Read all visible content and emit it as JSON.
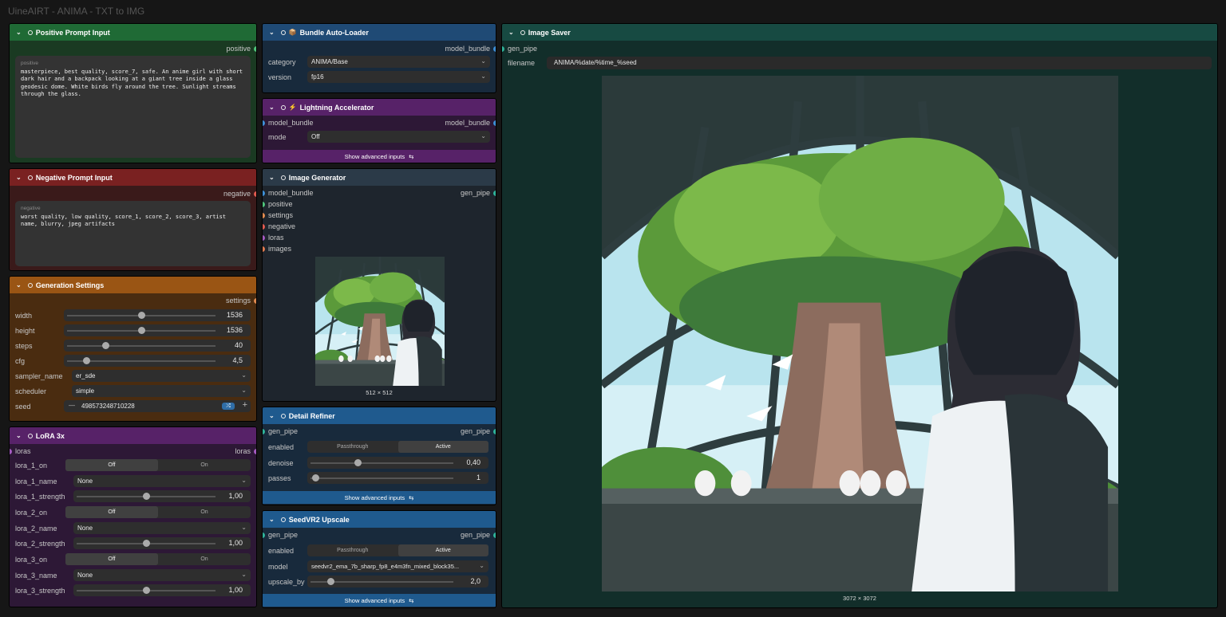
{
  "app": {
    "title": "UineAIRT - ANIMA - TXT to IMG"
  },
  "positive_node": {
    "title": "Positive Prompt Input",
    "output": "positive",
    "placeholder": "positive",
    "text": "masterpiece, best quality, score_7, safe. An anime girl with short dark hair and a backpack looking at a giant tree inside a glass geodesic dome. White birds fly around the tree. Sunlight streams through the glass."
  },
  "negative_node": {
    "title": "Negative Prompt Input",
    "output": "negative",
    "placeholder": "negative",
    "text": "worst quality, low quality, score_1, score_2, score_3, artist name, blurry, jpeg artifacts"
  },
  "settings_node": {
    "title": "Generation Settings",
    "output": "settings",
    "width_label": "width",
    "width": "1536",
    "width_fraction": 0.5,
    "height_label": "height",
    "height": "1536",
    "height_fraction": 0.5,
    "steps_label": "steps",
    "steps": "40",
    "steps_fraction": 0.26,
    "cfg_label": "cfg",
    "cfg": "4,5",
    "cfg_fraction": 0.13,
    "sampler_label": "sampler_name",
    "sampler": "er_sde",
    "scheduler_label": "scheduler",
    "scheduler": "simple",
    "seed_label": "seed",
    "seed": "498573248710228",
    "seed_minus": "—",
    "seed_plus": "+"
  },
  "lora_node": {
    "title": "LoRA 3x",
    "input": "loras",
    "output": "loras",
    "off": "Off",
    "on": "On",
    "l1_on": "lora_1_on",
    "l1_name": "lora_1_name",
    "l1_name_val": "None",
    "l1_strength": "lora_1_strength",
    "l1_strength_val": "1,00",
    "l2_on": "lora_2_on",
    "l2_name": "lora_2_name",
    "l2_name_val": "None",
    "l2_strength": "lora_2_strength",
    "l2_strength_val": "1,00",
    "l3_on": "lora_3_on",
    "l3_name": "lora_3_name",
    "l3_name_val": "None",
    "l3_strength": "lora_3_strength",
    "l3_strength_val": "1,00",
    "strength_fraction": 0.5
  },
  "bundle_node": {
    "title": "Bundle Auto-Loader",
    "output": "model_bundle",
    "category_label": "category",
    "category": "ANIMA/Base",
    "version_label": "version",
    "version": "fp16"
  },
  "lightning_node": {
    "title": "Lightning Accelerator",
    "input": "model_bundle",
    "output": "model_bundle",
    "mode_label": "mode",
    "mode": "Off",
    "advanced": "Show advanced inputs"
  },
  "generator_node": {
    "title": "Image Generator",
    "in_model": "model_bundle",
    "in_positive": "positive",
    "in_settings": "settings",
    "in_negative": "negative",
    "in_loras": "loras",
    "in_images": "images",
    "output": "gen_pipe",
    "preview_size": "512 × 512"
  },
  "refiner_node": {
    "title": "Detail Refiner",
    "input": "gen_pipe",
    "output": "gen_pipe",
    "enabled_label": "enabled",
    "passthrough": "Passthrough",
    "active": "Active",
    "denoise_label": "denoise",
    "denoise": "0,40",
    "denoise_fraction": 0.33,
    "passes_label": "passes",
    "passes": "1",
    "advanced": "Show advanced inputs"
  },
  "upscale_node": {
    "title": "SeedVR2 Upscale",
    "input": "gen_pipe",
    "output": "gen_pipe",
    "enabled_label": "enabled",
    "passthrough": "Passthrough",
    "active": "Active",
    "model_label": "model",
    "model": "seedvr2_ema_7b_sharp_fp8_e4m3fn_mixed_block35...",
    "upscale_label": "upscale_by",
    "upscale": "2,0",
    "upscale_fraction": 0.14,
    "advanced": "Show advanced inputs"
  },
  "saver_node": {
    "title": "Image Saver",
    "input": "gen_pipe",
    "filename_label": "filename",
    "filename": "ANIMA/%date/%time_%seed",
    "image_size": "3072 × 3072"
  },
  "colors": {
    "green": "#1d5b2c",
    "red": "#6b1f1f",
    "orange": "#8a4a12",
    "purple": "#4e1e5e",
    "blue": "#1f4a75",
    "teal": "#174a42"
  }
}
